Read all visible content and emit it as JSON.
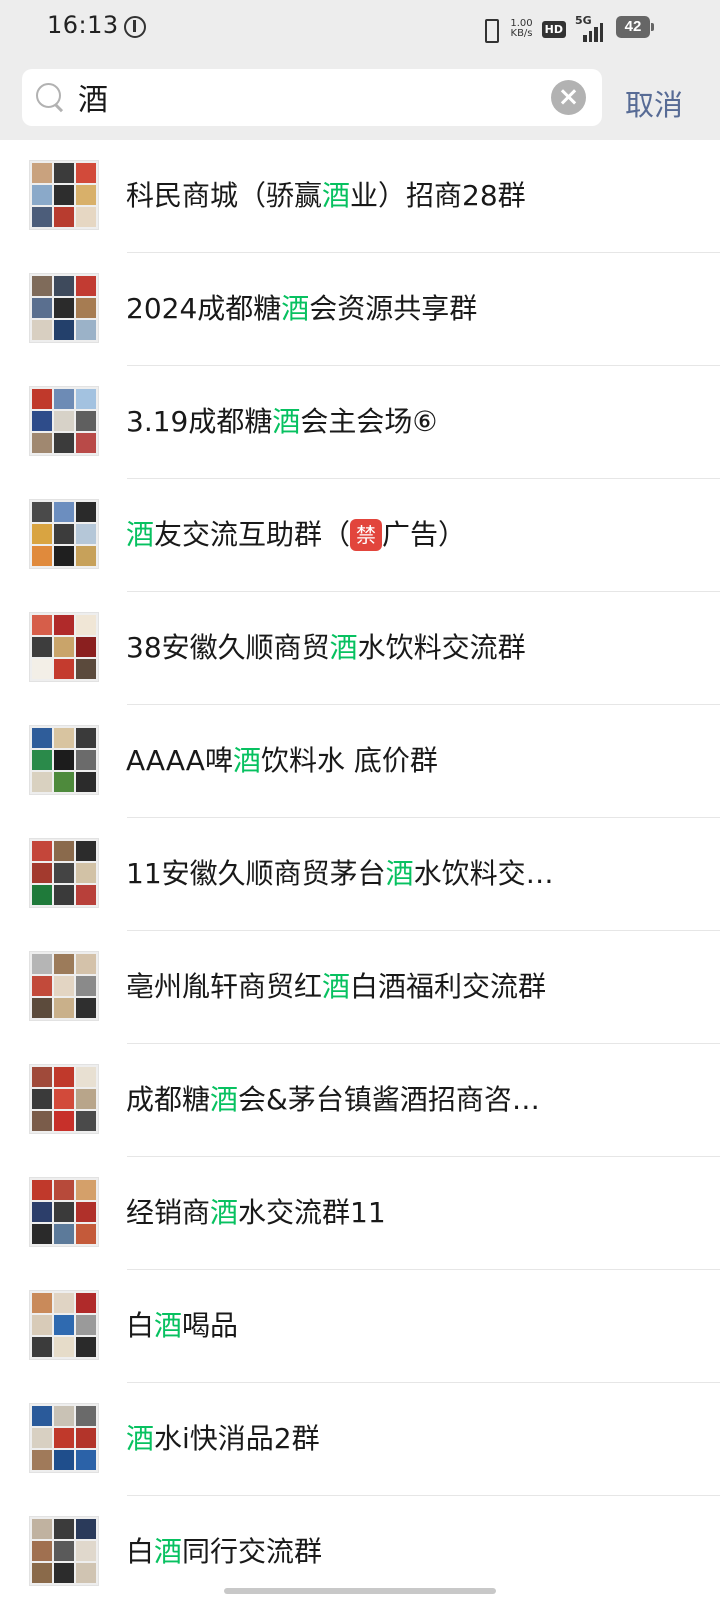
{
  "status_bar": {
    "time": "16:13",
    "net_speed_value": "1.00",
    "net_speed_unit": "KB/s",
    "hd_label": "HD",
    "network_label": "5G",
    "battery_level": "42"
  },
  "search": {
    "query": "酒",
    "cancel_label": "取消"
  },
  "colors": {
    "highlight": "#07c160",
    "link": "#576b95"
  },
  "results": [
    {
      "before": "科民商城（骄赢",
      "match": "酒",
      "after": "业）招商28群"
    },
    {
      "before": "2024成都糖",
      "match": "酒",
      "after": "会资源共享群"
    },
    {
      "before": "3.19成都糖",
      "match": "酒",
      "after": "会主会场⑥"
    },
    {
      "before": "",
      "match": "酒",
      "after": "友交流互助群（",
      "badge": "禁",
      "tail": "广告）"
    },
    {
      "before": "38安徽久顺商贸",
      "match": "酒",
      "after": "水饮料交流群"
    },
    {
      "before": "AAAA啤",
      "match": "酒",
      "after": "饮料水  底价群"
    },
    {
      "before": "11安徽久顺商贸茅台",
      "match": "酒",
      "after": "水饮料交…"
    },
    {
      "before": "亳州胤轩商贸红",
      "match": "酒",
      "after": "白酒福利交流群"
    },
    {
      "before": "成都糖",
      "match": "酒",
      "after": "会&茅台镇酱酒招商咨…"
    },
    {
      "before": "经销商",
      "match": "酒",
      "after": "水交流群11"
    },
    {
      "before": "白",
      "match": "酒",
      "after": "喝品"
    },
    {
      "before": "",
      "match": "酒",
      "after": "水i快消品2群"
    },
    {
      "before": "白",
      "match": "酒",
      "after": "同行交流群"
    }
  ]
}
